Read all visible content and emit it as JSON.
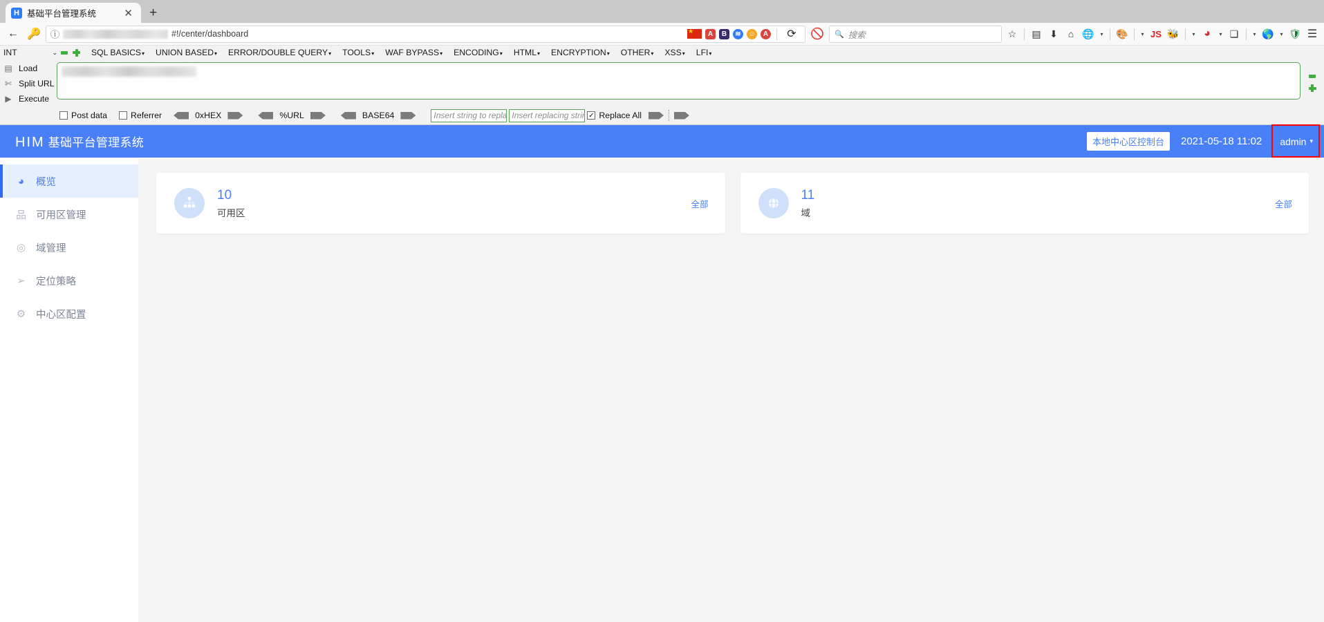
{
  "browser": {
    "tab": {
      "title": "基础平台管理系统",
      "favicon_letter": "H",
      "close_label": "✕"
    },
    "new_tab_label": "+",
    "nav": {
      "back_icon": "←",
      "forward_key_icon": "🔑",
      "info_icon": "i",
      "url_text": "#!/center/dashboard",
      "reload_icon": "⟳",
      "block_icon": "🚫",
      "search_placeholder": "搜索",
      "search_icon": "🔍"
    },
    "extensions": [
      {
        "name": "angular-icon",
        "letter": "A",
        "color": "#d9443f"
      },
      {
        "name": "bootstrap-icon",
        "letter": "B",
        "color": "#3b2a6b"
      },
      {
        "name": "wave-icon",
        "letter": "≋",
        "color": "#2f7cf6"
      },
      {
        "name": "smiley-icon",
        "letter": "☺",
        "color": "#f5a623"
      },
      {
        "name": "adblock-icon",
        "letter": "A",
        "color": "#d9443f"
      }
    ],
    "toolbar_icons": [
      {
        "name": "bookmark-star-icon",
        "glyph": "☆"
      },
      {
        "name": "library-icon",
        "glyph": "▤"
      },
      {
        "name": "downloads-icon",
        "glyph": "⬇"
      },
      {
        "name": "home-icon",
        "glyph": "⌂"
      },
      {
        "name": "globe-icon",
        "glyph": "🌐"
      },
      {
        "name": "palette-icon",
        "glyph": "🎨"
      },
      {
        "name": "javascript-icon",
        "glyph": "JS"
      },
      {
        "name": "bug-icon",
        "glyph": "🐝"
      },
      {
        "name": "hackbar-icon",
        "glyph": "◕"
      },
      {
        "name": "copy-pages-icon",
        "glyph": "❏"
      },
      {
        "name": "browser-globe-icon",
        "glyph": "🌎"
      },
      {
        "name": "shield-icon",
        "glyph": "🛡"
      },
      {
        "name": "menu-hamburger-icon",
        "glyph": "☰"
      }
    ]
  },
  "hackbar": {
    "type_select": {
      "value": "INT",
      "caret": "⌄"
    },
    "minus_label": "−",
    "plus_label": "+",
    "menus": [
      {
        "label": "SQL BASICS",
        "caret": "▾"
      },
      {
        "label": "UNION BASED",
        "caret": "▾"
      },
      {
        "label": "ERROR/DOUBLE QUERY",
        "caret": "▾"
      },
      {
        "label": "TOOLS",
        "caret": "▾"
      },
      {
        "label": "WAF BYPASS",
        "caret": "▾"
      },
      {
        "label": "ENCODING",
        "caret": "▾"
      },
      {
        "label": "HTML",
        "caret": "▾"
      },
      {
        "label": "ENCRYPTION",
        "caret": "▾"
      },
      {
        "label": "OTHER",
        "caret": "▾"
      },
      {
        "label": "XSS",
        "caret": "▾"
      },
      {
        "label": "LFI",
        "caret": "▾"
      }
    ],
    "actions": [
      {
        "label": "Load",
        "icon": "⎙"
      },
      {
        "label": "Split URL",
        "icon": "✂"
      },
      {
        "label": "Execute",
        "icon": "▶"
      }
    ],
    "options": {
      "post_data_label": "Post data",
      "post_data_checked": false,
      "referrer_label": "Referrer",
      "referrer_checked": false,
      "hex_label": "0xHEX",
      "url_label": "%URL",
      "base64_label": "BASE64",
      "replace_from_placeholder": "Insert string to replace",
      "replace_from_value": "",
      "replace_to_placeholder": "Insert replacing string",
      "replace_to_value": "",
      "replace_all_label": "Replace All",
      "replace_all_checked": true
    }
  },
  "app": {
    "header": {
      "brand_main": "HIM",
      "brand_sub": "基础平台管理系统",
      "console_button": "本地中心区控制台",
      "datetime": "2021-05-18 11:02",
      "user": "admin",
      "user_caret": "▾",
      "accent_color": "#4a80f7",
      "highlight_color": "#ff0000"
    },
    "sidebar": {
      "items": [
        {
          "label": "概览",
          "icon": "dashboard-icon",
          "glyph": "◕",
          "active": true
        },
        {
          "label": "可用区管理",
          "icon": "sitemap-icon",
          "glyph": "品",
          "active": false
        },
        {
          "label": "域管理",
          "icon": "domain-icon",
          "glyph": "◎",
          "active": false
        },
        {
          "label": "定位策略",
          "icon": "navigate-icon",
          "glyph": "➤",
          "active": false
        },
        {
          "label": "中心区配置",
          "icon": "gear-icon",
          "glyph": "⚙",
          "active": false
        }
      ]
    },
    "cards": [
      {
        "count": "10",
        "label": "可用区",
        "link": "全部",
        "icon": "sitemap-icon",
        "glyph": "▫"
      },
      {
        "count": "11",
        "label": "域",
        "link": "全部",
        "icon": "domain-globe-icon",
        "glyph": "◍"
      }
    ]
  }
}
